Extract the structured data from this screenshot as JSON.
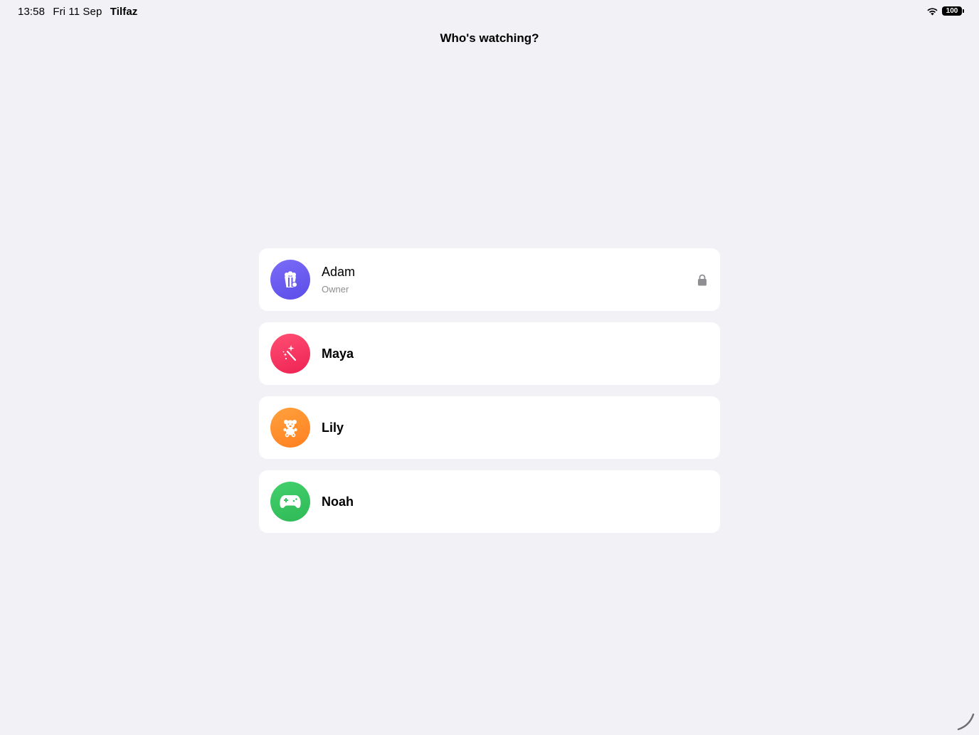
{
  "status_bar": {
    "time": "13:58",
    "date": "Fri 11 Sep",
    "app_name": "Tilfaz",
    "battery_level": "100",
    "icons": [
      "wifi-icon",
      "battery-icon"
    ]
  },
  "title": "Who's watching?",
  "profiles": [
    {
      "name": "Adam",
      "role": "Owner",
      "icon": "popcorn-icon",
      "color": "#6a5cf0",
      "locked": true
    },
    {
      "name": "Maya",
      "role": "",
      "icon": "magic-wand-icon",
      "color": "#f7335f",
      "locked": false
    },
    {
      "name": "Lily",
      "role": "",
      "icon": "teddy-bear-icon",
      "color": "#ff8d2a",
      "locked": false
    },
    {
      "name": "Noah",
      "role": "",
      "icon": "gamepad-icon",
      "color": "#38c461",
      "locked": false
    }
  ],
  "lock_icon": "lock-icon"
}
